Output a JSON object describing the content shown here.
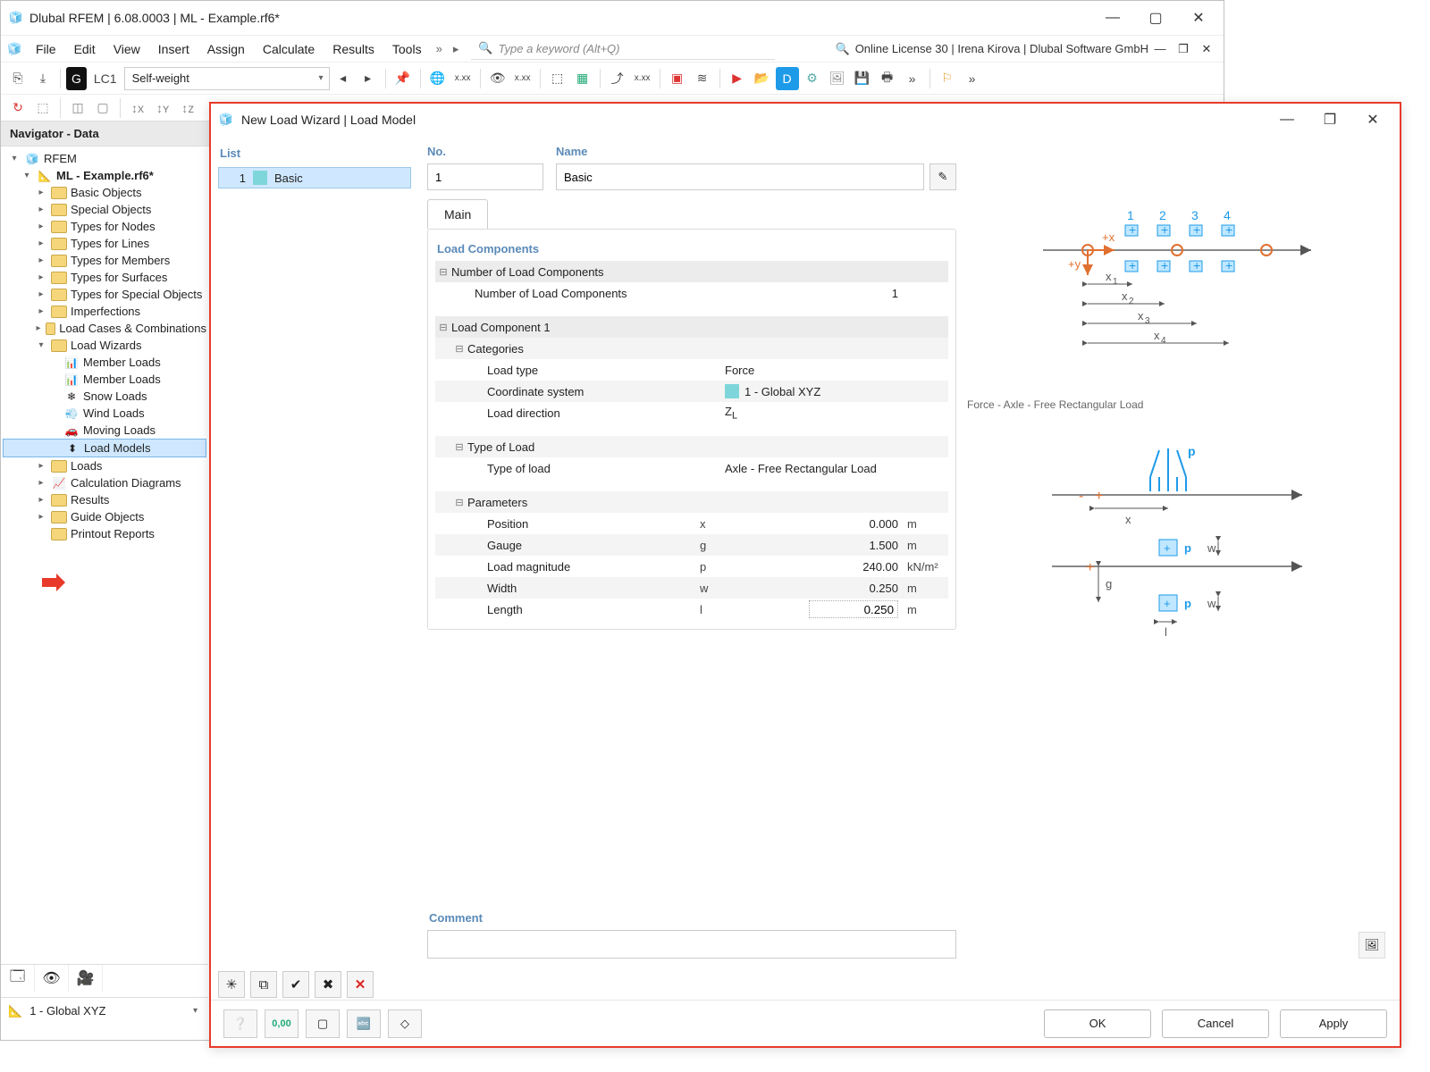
{
  "app": {
    "title": "Dlubal RFEM | 6.08.0003 | ML - Example.rf6*",
    "license": "Online License 30 | Irena Kirova | Dlubal Software GmbH",
    "search_placeholder": "Type a keyword (Alt+Q)"
  },
  "menu": [
    "File",
    "Edit",
    "View",
    "Insert",
    "Assign",
    "Calculate",
    "Results",
    "Tools"
  ],
  "toolbar": {
    "lc_code": "G",
    "lc_num": "LC1",
    "lc_name": "Self-weight"
  },
  "navigator": {
    "title": "Navigator - Data",
    "root": "RFEM",
    "project": "ML - Example.rf6*",
    "folders": [
      "Basic Objects",
      "Special Objects",
      "Types for Nodes",
      "Types for Lines",
      "Types for Members",
      "Types for Surfaces",
      "Types for Special Objects",
      "Imperfections",
      "Load Cases & Combinations",
      "Load Wizards"
    ],
    "wizards": [
      "Member Loads",
      "Member Loads",
      "Snow Loads",
      "Wind Loads",
      "Moving Loads",
      "Load Models"
    ],
    "after": [
      "Loads",
      "Calculation Diagrams",
      "Results",
      "Guide Objects",
      "Printout Reports"
    ],
    "selected": "Load Models",
    "coord_system": "1 - Global XYZ"
  },
  "dialog": {
    "title": "New Load Wizard | Load Model",
    "list_header": "List",
    "list": [
      {
        "num": "1",
        "name": "Basic"
      }
    ],
    "no_label": "No.",
    "no_value": "1",
    "name_label": "Name",
    "name_value": "Basic",
    "tab_main": "Main",
    "groups": {
      "load_components": "Load Components",
      "num_components_section": "Number of Load Components",
      "num_components": "Number of Load Components",
      "num_components_val": "1",
      "component1": "Load Component 1",
      "categories": "Categories",
      "load_type": "Load type",
      "load_type_val": "Force",
      "coord_sys": "Coordinate system",
      "coord_sys_val": "1 - Global XYZ",
      "load_dir": "Load direction",
      "load_dir_val": "Z",
      "load_dir_sub": "L",
      "type_of_load_h": "Type of Load",
      "type_of_load": "Type of load",
      "type_of_load_val": "Axle - Free Rectangular Load",
      "parameters_h": "Parameters",
      "rows": [
        {
          "label": "Position",
          "sym": "x",
          "val": "0.000",
          "unit": "m"
        },
        {
          "label": "Gauge",
          "sym": "g",
          "val": "1.500",
          "unit": "m"
        },
        {
          "label": "Load magnitude",
          "sym": "p",
          "val": "240.00",
          "unit": "kN/m²"
        },
        {
          "label": "Width",
          "sym": "w",
          "val": "0.250",
          "unit": "m"
        },
        {
          "label": "Length",
          "sym": "l",
          "val": "0.250",
          "unit": "m",
          "editing": true
        }
      ]
    },
    "right_caption": "Force - Axle - Free Rectangular Load",
    "comment_label": "Comment",
    "buttons": {
      "ok": "OK",
      "cancel": "Cancel",
      "apply": "Apply"
    }
  }
}
